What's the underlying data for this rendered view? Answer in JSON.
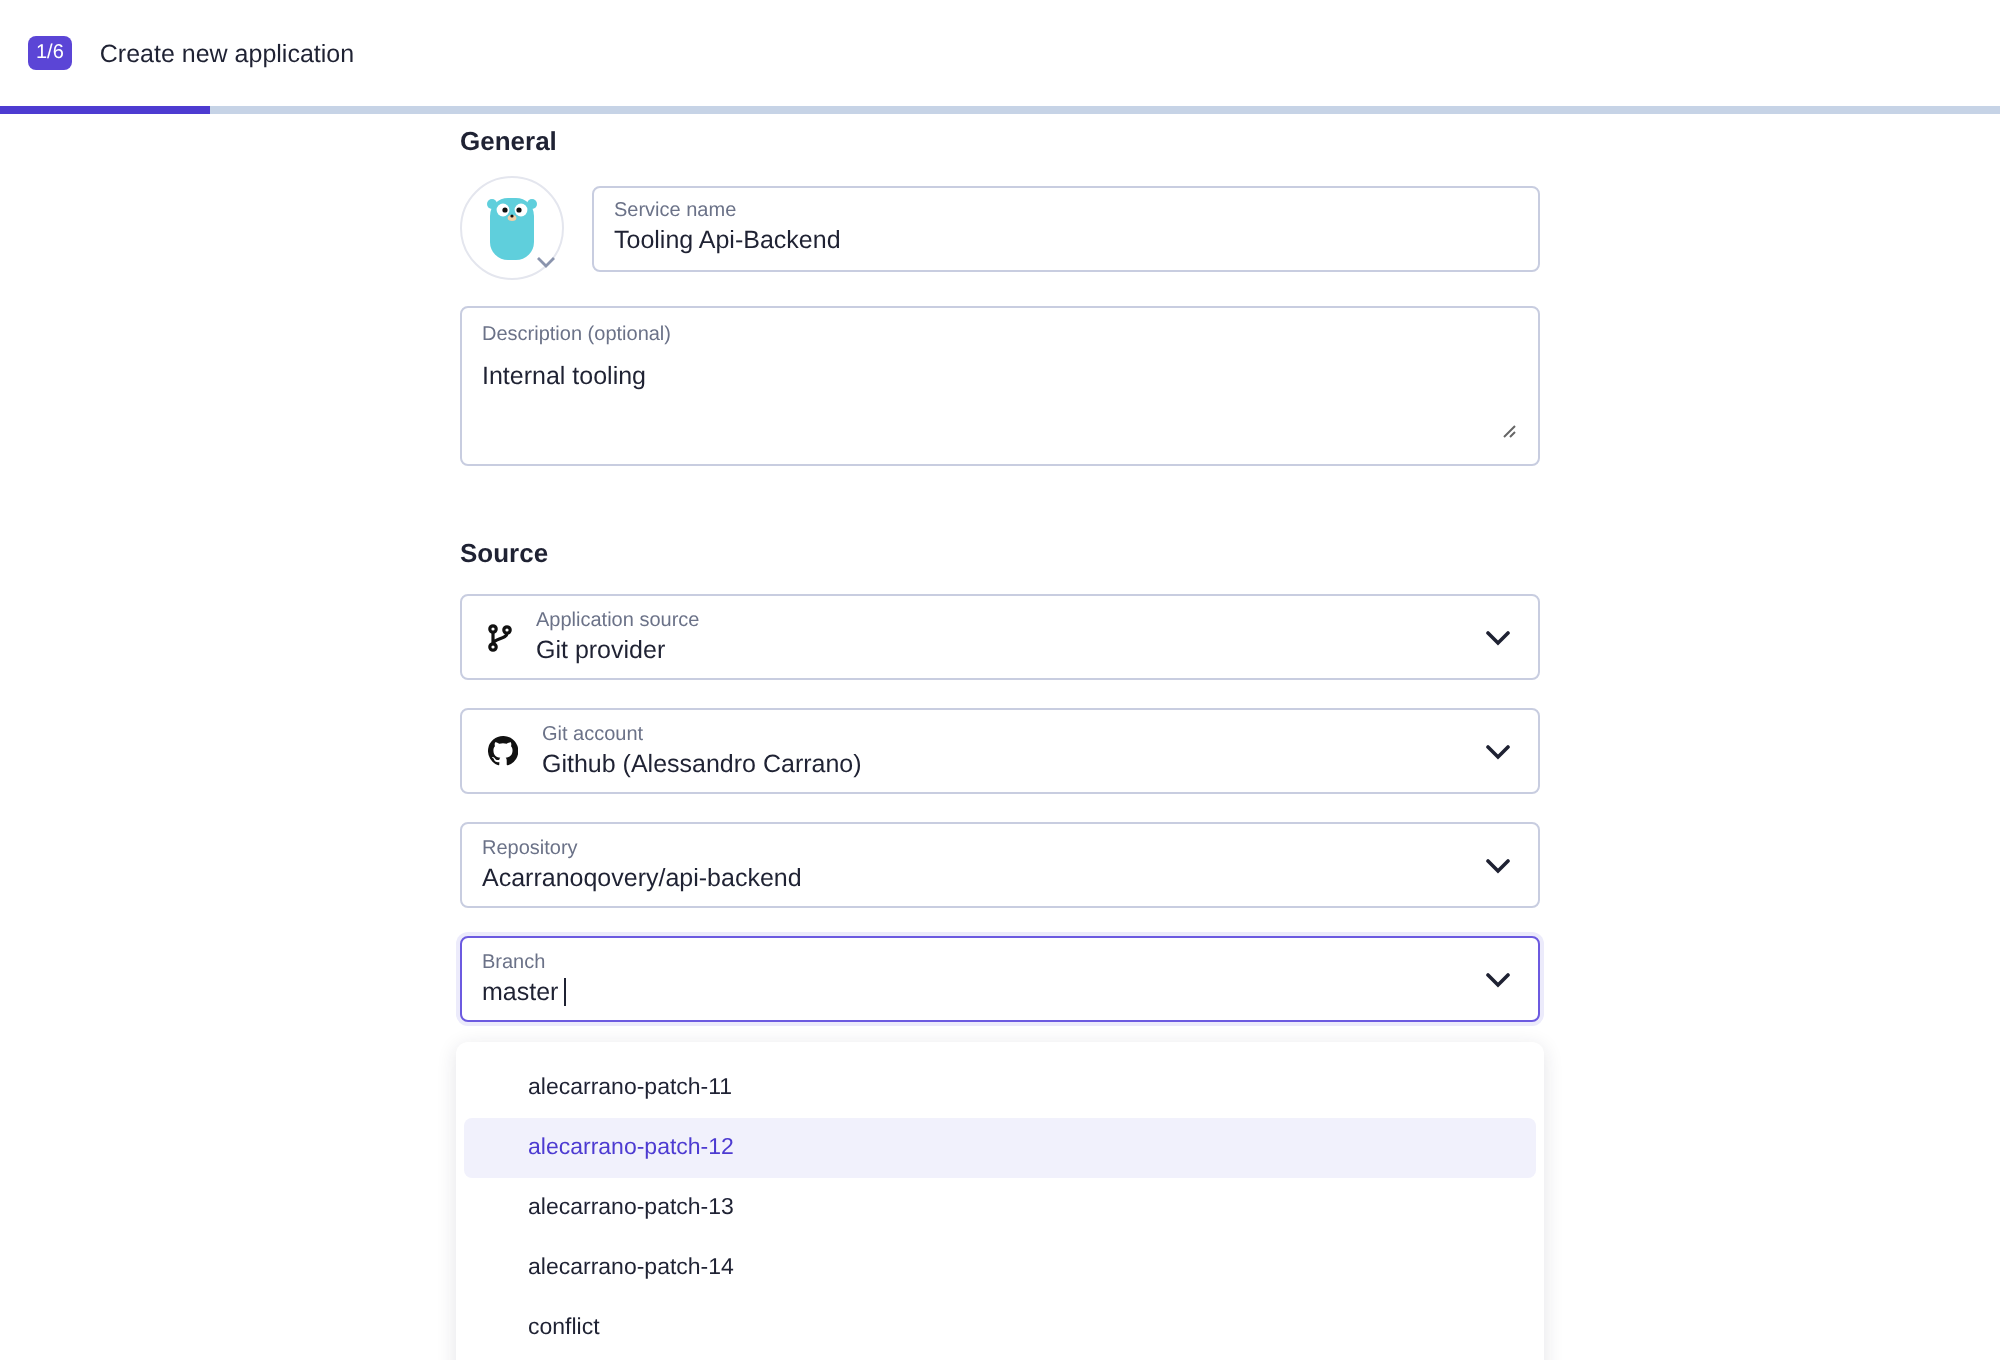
{
  "header": {
    "step_badge": "1/6",
    "title": "Create new application",
    "progress": {
      "level": 0.105
    }
  },
  "general": {
    "heading": "General",
    "service_name": {
      "label": "Service name",
      "value": "Tooling Api-Backend"
    },
    "description": {
      "label": "Description (optional)",
      "value": "Internal tooling"
    }
  },
  "source": {
    "heading": "Source",
    "fields": [
      {
        "label": "Application source",
        "value": "Git provider",
        "kind": "source",
        "focused": false
      },
      {
        "label": "Git account",
        "value": "Github (Alessandro Carrano)",
        "kind": "account",
        "focused": false
      },
      {
        "label": "Repository",
        "value": "Acarranoqovery/api-backend",
        "kind": "plain",
        "focused": false
      },
      {
        "label": "Branch",
        "value": "master",
        "kind": "plain",
        "focused": true
      }
    ]
  },
  "branch_options": [
    {
      "label": "alecarrano-patch-11",
      "selected": false
    },
    {
      "label": "alecarrano-patch-12",
      "selected": true
    },
    {
      "label": "alecarrano-patch-13",
      "selected": false
    },
    {
      "label": "alecarrano-patch-14",
      "selected": false
    },
    {
      "label": "conflict",
      "selected": false
    }
  ]
}
